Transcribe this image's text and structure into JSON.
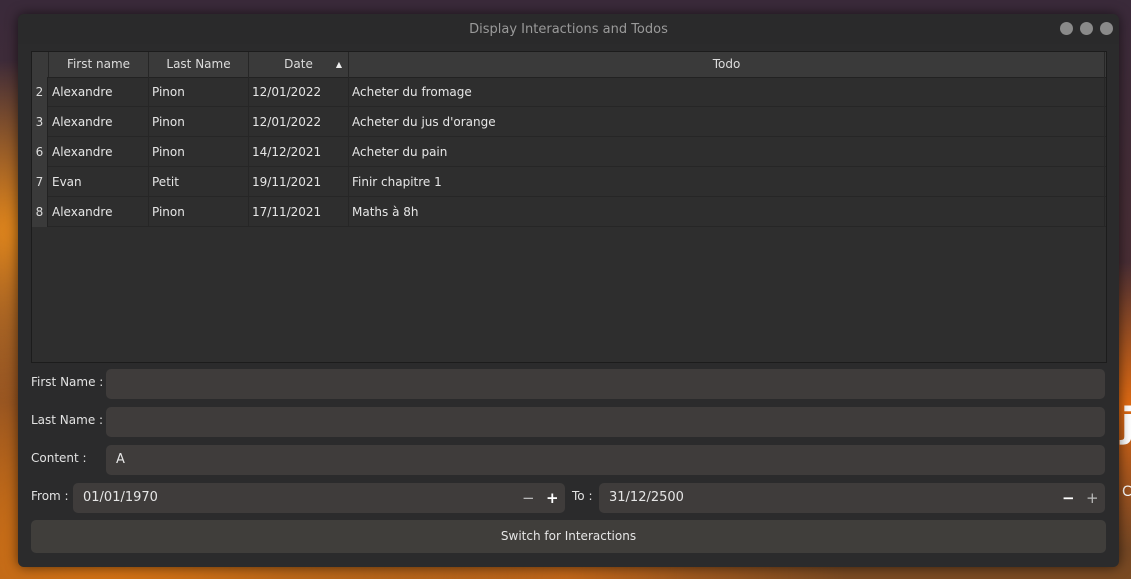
{
  "window": {
    "title": "Display Interactions and Todos"
  },
  "table": {
    "headers": [
      "First name",
      "Last Name",
      "Date",
      "Todo"
    ],
    "rows": [
      {
        "num": "2",
        "first": "Alexandre",
        "last": "Pinon",
        "date": "12/01/2022",
        "todo": "Acheter du fromage"
      },
      {
        "num": "3",
        "first": "Alexandre",
        "last": "Pinon",
        "date": "12/01/2022",
        "todo": "Acheter du jus d'orange"
      },
      {
        "num": "6",
        "first": "Alexandre",
        "last": "Pinon",
        "date": "14/12/2021",
        "todo": "Acheter du pain"
      },
      {
        "num": "7",
        "first": "Evan",
        "last": "Petit",
        "date": "19/11/2021",
        "todo": "Finir chapitre 1"
      },
      {
        "num": "8",
        "first": "Alexandre",
        "last": "Pinon",
        "date": "17/11/2021",
        "todo": "Maths à 8h"
      }
    ]
  },
  "filters": {
    "first_name_label": "First Name :",
    "first_name_value": "",
    "last_name_label": "Last Name :",
    "last_name_value": "",
    "content_label": "Content :",
    "content_value": "A",
    "from_label": "From :",
    "from_value": "01/01/1970",
    "to_label": "To :",
    "to_value": "31/12/2500",
    "minus": "−",
    "plus": "+"
  },
  "switch_button": "Switch for Interactions",
  "desktop": {
    "glyph1": "j",
    "glyph2": "C"
  }
}
